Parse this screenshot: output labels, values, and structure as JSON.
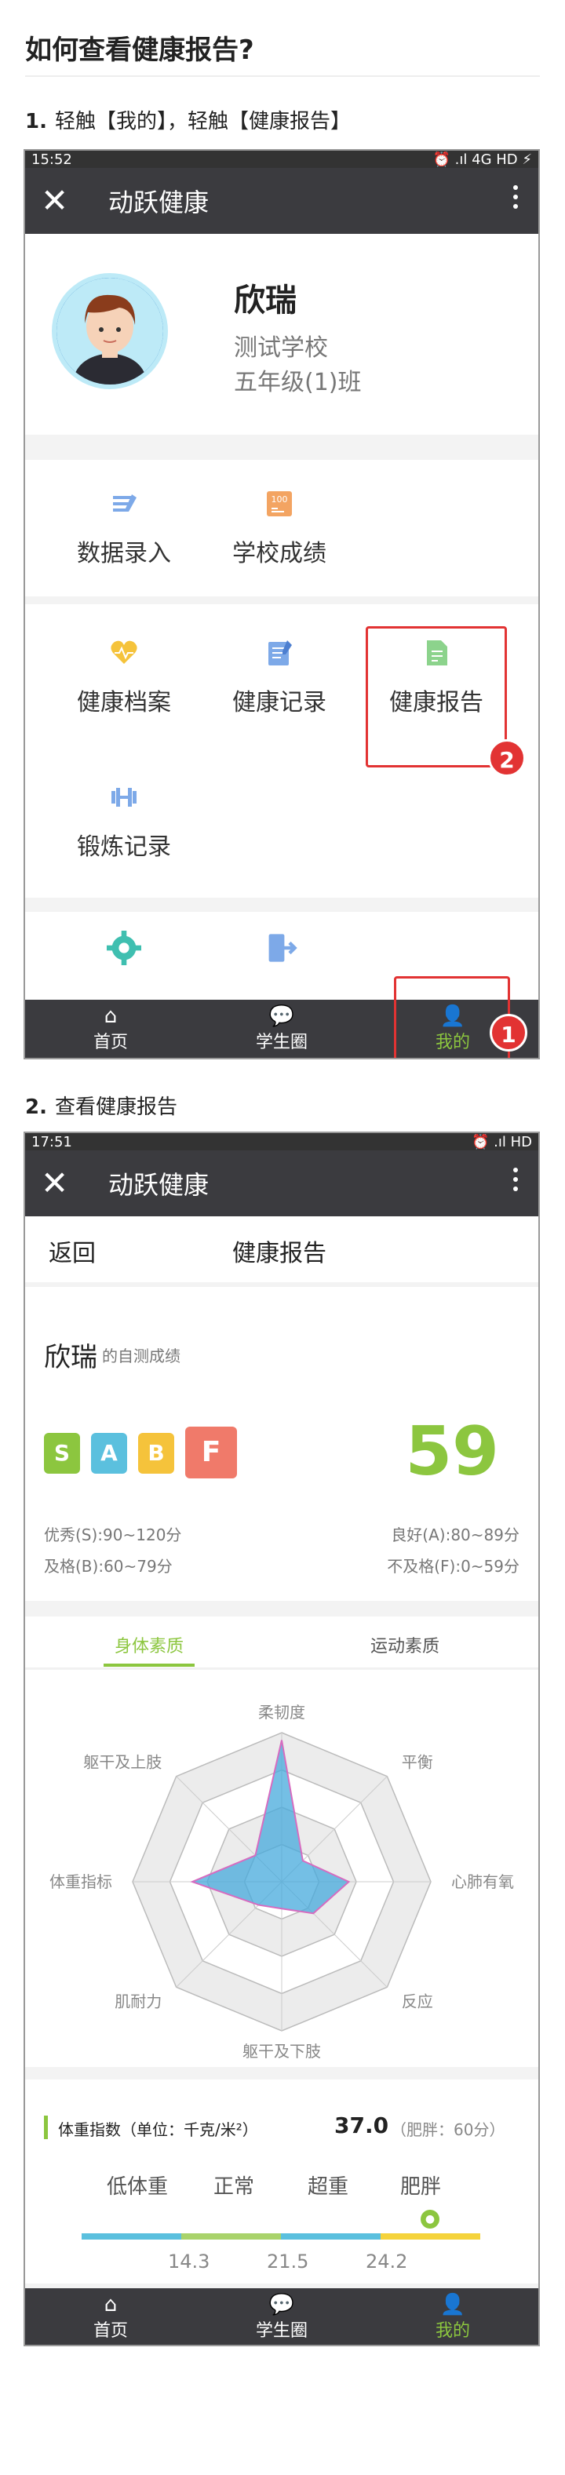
{
  "page_title": "如何查看健康报告?",
  "step1": {
    "num": "1.",
    "text": "轻触【我的】，轻触【健康报告】"
  },
  "step2": {
    "num": "2.",
    "text": "查看健康报告"
  },
  "phone1": {
    "status_time": "15:52",
    "status_right": "⏰ .ıl 4G HD ⚡",
    "app_title": "动跃健康",
    "profile": {
      "name": "欣瑞",
      "school": "测试学校",
      "class": "五年级(1)班"
    },
    "menu": [
      {
        "label": "数据录入",
        "icon": "data-entry-icon"
      },
      {
        "label": "学校成绩",
        "icon": "school-score-icon"
      },
      {
        "label": "健康档案",
        "icon": "health-file-icon"
      },
      {
        "label": "健康记录",
        "icon": "health-record-icon"
      },
      {
        "label": "健康报告",
        "icon": "health-report-icon"
      },
      {
        "label": "锻炼记录",
        "icon": "exercise-record-icon"
      }
    ],
    "badge_report": "2",
    "badge_mine": "1",
    "nav": [
      {
        "label": "首页"
      },
      {
        "label": "学生圈"
      },
      {
        "label": "我的"
      }
    ]
  },
  "phone2": {
    "status_time": "17:51",
    "status_right": "⏰ .ıl HD",
    "app_title": "动跃健康",
    "back_label": "返回",
    "header_title": "健康报告",
    "student_name": "欣瑞",
    "student_sub": "的自测成绩",
    "grades": [
      {
        "letter": "S",
        "color": "#8cc63f"
      },
      {
        "letter": "A",
        "color": "#5bc0de"
      },
      {
        "letter": "B",
        "color": "#f5c33b"
      },
      {
        "letter": "F",
        "color": "#f07a6a"
      }
    ],
    "score": "59",
    "ranges": {
      "s": "优秀(S):90~120分",
      "a": "良好(A):80~89分",
      "b": "及格(B):60~79分",
      "f": "不及格(F):0~59分"
    },
    "tabs": [
      {
        "label": "身体素质"
      },
      {
        "label": "运动素质"
      }
    ],
    "radar_labels": [
      "柔韧度",
      "平衡",
      "心肺有氧",
      "反应",
      "躯干及下肢",
      "肌耐力",
      "体重指标",
      "躯干及上肢"
    ],
    "radar_values": [
      0.95,
      0.2,
      0.45,
      0.3,
      0.18,
      0.22,
      0.6,
      0.25
    ],
    "bmi": {
      "title": "体重指数（单位：千克/米²）",
      "value": "37.0",
      "note": "（肥胖：60分）",
      "categories": [
        "低体重",
        "正常",
        "超重",
        "肥胖"
      ],
      "thresholds": [
        "14.3",
        "21.5",
        "24.2"
      ],
      "bar_colors": [
        "#5bc0de",
        "#a9d36b",
        "#5bc0de",
        "#f5d33b"
      ]
    },
    "nav": [
      {
        "label": "首页"
      },
      {
        "label": "学生圈"
      },
      {
        "label": "我的"
      }
    ]
  },
  "colors": {
    "accent": "#8cc63f",
    "highlight": "#e23333",
    "appbar": "#3b3b3f"
  }
}
